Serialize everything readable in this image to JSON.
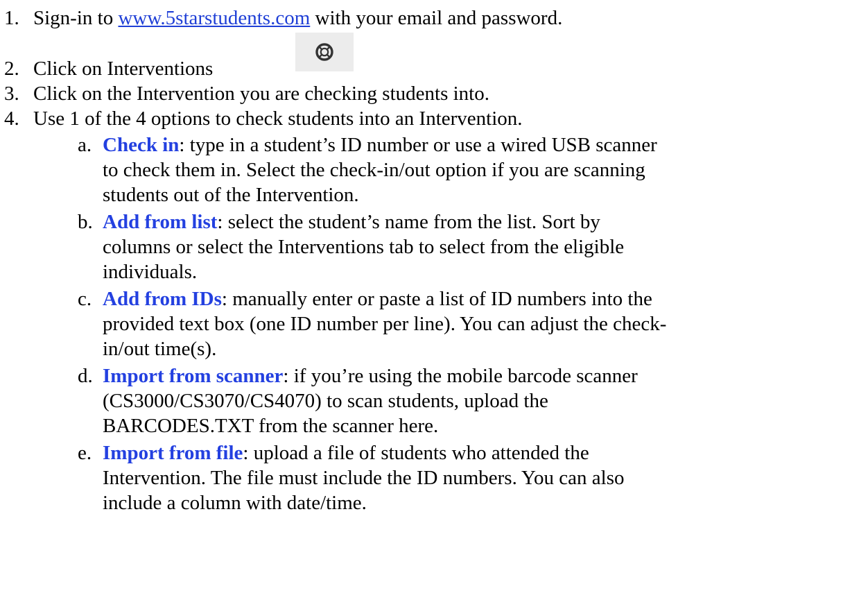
{
  "steps": [
    {
      "number": "1.",
      "before_link": "Sign-in to ",
      "link": "www.5starstudents.com",
      "after_link": " with your email and password."
    },
    {
      "number": "2.",
      "text": "Click on Interventions",
      "icon": "lifebuoy-icon"
    },
    {
      "number": "3.",
      "text": "Click on the Intervention you are checking students into."
    },
    {
      "number": "4.",
      "text": "Use 1 of the 4 options to check students into an Intervention."
    }
  ],
  "options": [
    {
      "letter": "a.",
      "term": "Check in",
      "lines": [
        ": type in a student’s ID number or use a wired USB scanner",
        "to check them in. Select the check-in/out option if you are scanning",
        "students out of the Intervention."
      ]
    },
    {
      "letter": "b.",
      "term": "Add from list",
      "lines": [
        ": select the student’s name from the list. Sort by",
        "columns or select the Interventions tab to select from the eligible",
        "individuals."
      ]
    },
    {
      "letter": "c.",
      "term": "Add from IDs",
      "lines": [
        ": manually enter or paste a list of ID numbers into the",
        "provided text box (one ID number per line). You can adjust the check-",
        "in/out time(s)."
      ]
    },
    {
      "letter": "d.",
      "term": "Import from scanner",
      "lines": [
        ": if you’re using the mobile barcode scanner",
        "(CS3000/CS3070/CS4070) to scan students, upload the",
        "BARCODES.TXT from the scanner here."
      ]
    },
    {
      "letter": "e.",
      "term": "Import from file",
      "lines": [
        ": upload a file of students who attended the",
        "Intervention. The file must include the ID numbers. You can also",
        "include a column with date/time."
      ]
    }
  ],
  "colors": {
    "link": "#1f3fd6",
    "term": "#2340e0",
    "icon_background": "#ececec"
  }
}
